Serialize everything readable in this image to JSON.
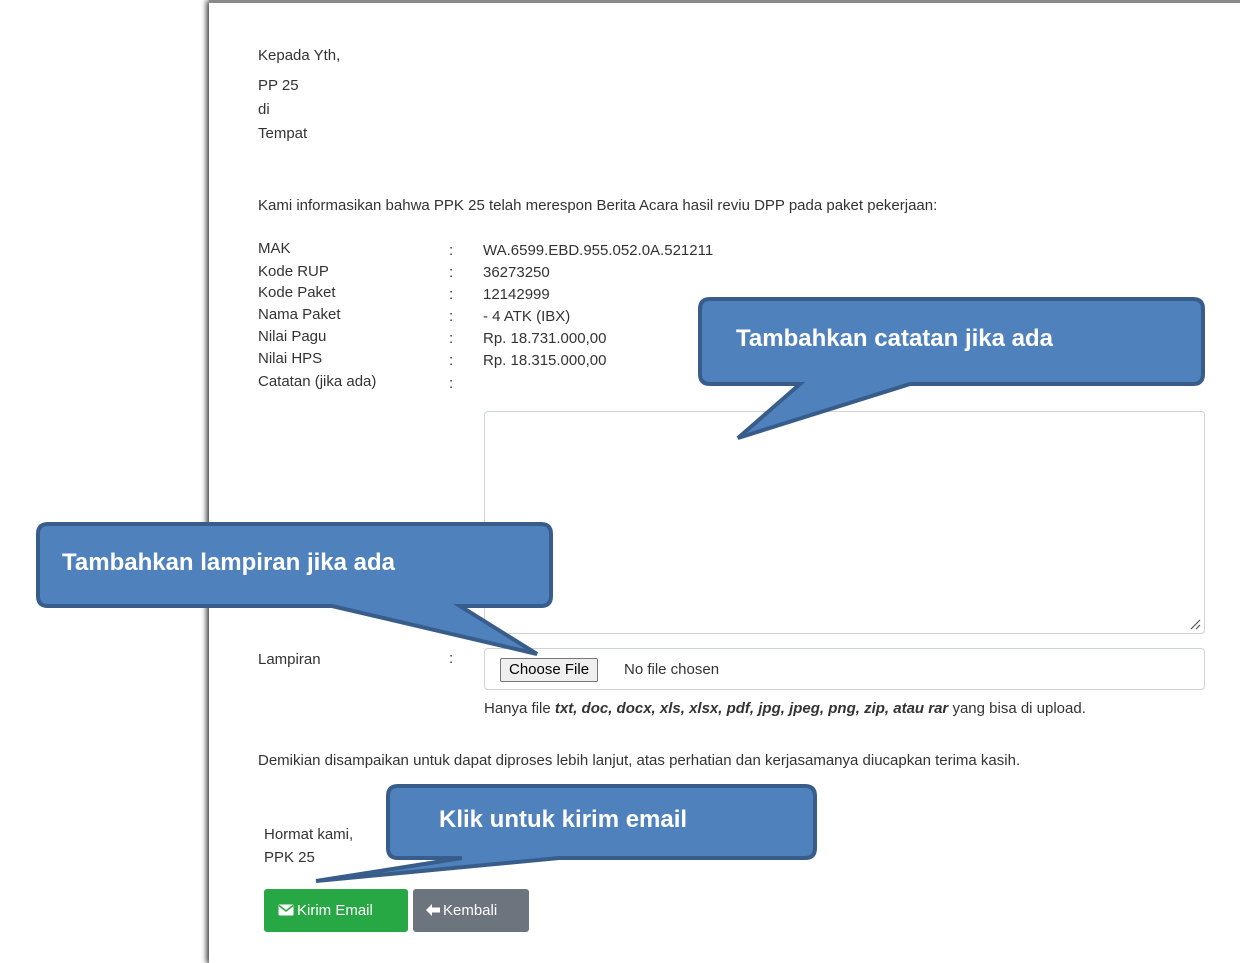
{
  "letter": {
    "greeting": [
      "Kepada Yth,",
      "PP 25",
      "di",
      "Tempat"
    ],
    "intro": "Kami informasikan bahwa PPK 25 telah merespon Berita Acara hasil reviu DPP pada paket pekerjaan:",
    "colon": ":",
    "fields": [
      {
        "label": "MAK",
        "value": "WA.6599.EBD.955.052.0A.521211"
      },
      {
        "label": "Kode RUP",
        "value": "36273250"
      },
      {
        "label": "Kode Paket",
        "value": "12142999"
      },
      {
        "label": "Nama Paket",
        "value": "- 4 ATK (IBX)"
      },
      {
        "label": "Nilai Pagu",
        "value": "Rp. 18.731.000,00"
      },
      {
        "label": "Nilai HPS",
        "value": "Rp. 18.315.000,00"
      }
    ],
    "notes_label": "Catatan (jika ada)",
    "notes_value": "",
    "attachment_label": "Lampiran",
    "file_button": "Choose File",
    "file_status": "No file chosen",
    "hint_prefix": "Hanya file ",
    "hint_types": "txt, doc, docx, xls, xlsx, pdf, jpg, jpeg, png, zip, atau rar",
    "hint_suffix": " yang bisa di upload.",
    "closing": "Demikian disampaikan untuk dapat diproses lebih lanjut, atas perhatian dan kerjasamanya diucapkan terima kasih.",
    "signoff": [
      "Hormat kami,",
      "PPK 25"
    ]
  },
  "buttons": {
    "send": "Kirim Email",
    "back": "Kembali"
  },
  "callouts": {
    "notes": "Tambahkan catatan jika ada",
    "attachment": "Tambahkan lampiran jika ada",
    "send": "Klik untuk kirim email"
  },
  "colors": {
    "callout_fill": "#4f81bd",
    "callout_border": "#385d8a",
    "send_button": "#28a745",
    "back_button": "#6c757d"
  }
}
